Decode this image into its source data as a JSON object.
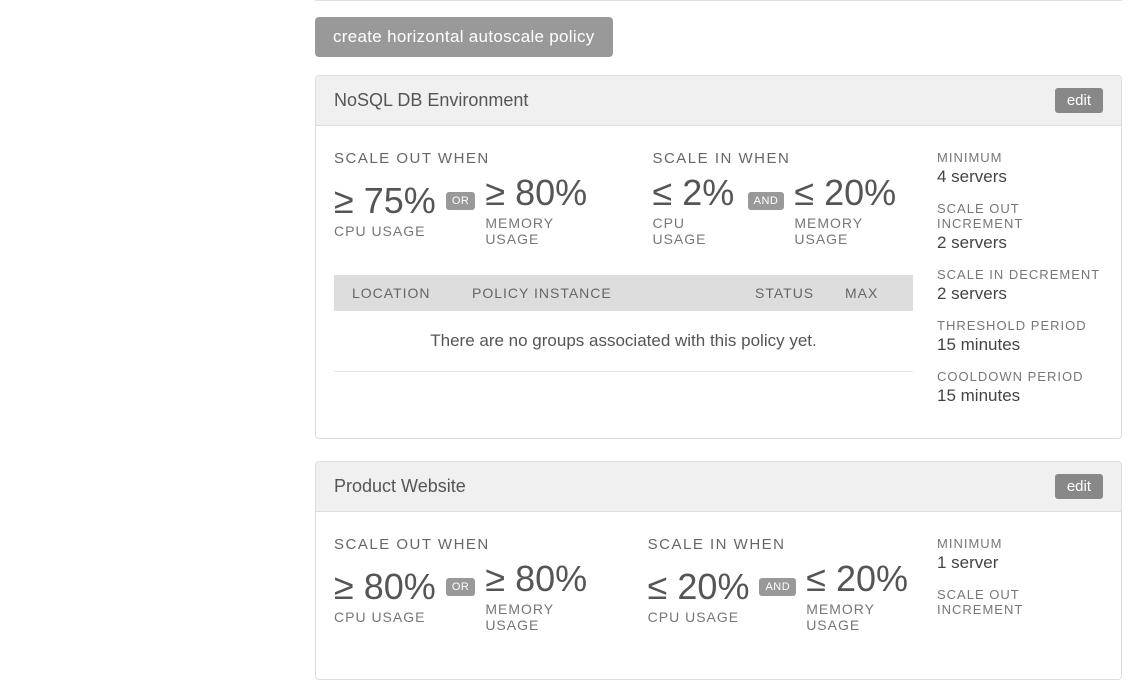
{
  "create_button_label": "create horizontal autoscale policy",
  "edit_label": "edit",
  "table_headers": {
    "location": "LOCATION",
    "instance": "POLICY INSTANCE",
    "status": "STATUS",
    "max": "MAX"
  },
  "table_empty_message": "There are no groups associated with this policy yet.",
  "sidebar_labels": {
    "minimum": "MINIMUM",
    "scale_out_increment": "SCALE OUT INCREMENT",
    "scale_in_decrement": "SCALE IN DECREMENT",
    "threshold_period": "THRESHOLD PERIOD",
    "cooldown_period": "COOLDOWN PERIOD"
  },
  "condition_labels": {
    "scale_out": "SCALE OUT WHEN",
    "scale_in": "SCALE IN WHEN",
    "cpu": "CPU USAGE",
    "memory": "MEMORY USAGE"
  },
  "policies": [
    {
      "title": "NoSQL DB Environment",
      "scale_out": {
        "cpu": "≥ 75%",
        "connector": "OR",
        "memory": "≥ 80%"
      },
      "scale_in": {
        "cpu": "≤ 2%",
        "connector": "AND",
        "memory": "≤ 20%"
      },
      "minimum": "4 servers",
      "scale_out_increment": "2 servers",
      "scale_in_decrement": "2 servers",
      "threshold_period": "15 minutes",
      "cooldown_period": "15 minutes"
    },
    {
      "title": "Product Website",
      "scale_out": {
        "cpu": "≥ 80%",
        "connector": "OR",
        "memory": "≥ 80%"
      },
      "scale_in": {
        "cpu": "≤ 20%",
        "connector": "AND",
        "memory": "≤ 20%"
      },
      "minimum": "1 server",
      "scale_out_increment": "",
      "scale_in_decrement": "",
      "threshold_period": "",
      "cooldown_period": ""
    }
  ]
}
